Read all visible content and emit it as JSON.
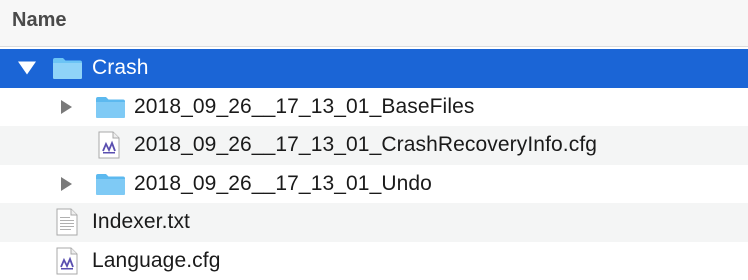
{
  "header": {
    "name_column": "Name"
  },
  "rows": [
    {
      "label": "Crash",
      "icon": "folder-icon",
      "expanded": true,
      "selected": true
    },
    {
      "label": "2018_09_26__17_13_01_BaseFiles",
      "icon": "folder-icon",
      "expanded": false
    },
    {
      "label": "2018_09_26__17_13_01_CrashRecoveryInfo.cfg",
      "icon": "cfg-file-icon"
    },
    {
      "label": "2018_09_26__17_13_01_Undo",
      "icon": "folder-icon",
      "expanded": false
    },
    {
      "label": "Indexer.txt",
      "icon": "text-file-icon"
    },
    {
      "label": "Language.cfg",
      "icon": "cfg-file-icon"
    }
  ],
  "colors": {
    "selection": "#1b65d6",
    "folder": "#6cc4f5",
    "alternate_row": "#f4f5f5"
  }
}
